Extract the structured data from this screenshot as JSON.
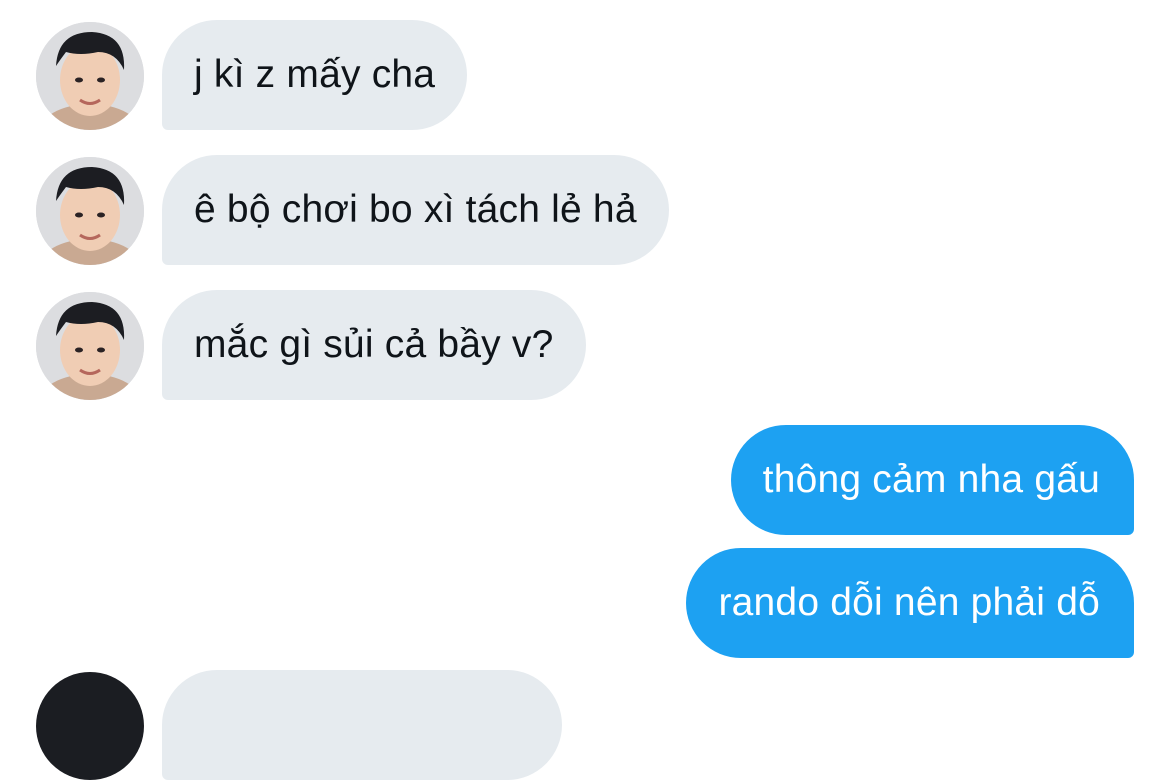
{
  "messages": [
    {
      "side": "incoming",
      "text": "j kì z mấy cha"
    },
    {
      "side": "incoming",
      "text": "ê bộ chơi bo xì tách lẻ hả"
    },
    {
      "side": "incoming",
      "text": "mắc gì sủi cả bầy v?"
    },
    {
      "side": "outgoing",
      "text": "thông cảm nha gấu"
    },
    {
      "side": "outgoing",
      "text": "rando dỗi nên phải dỗ"
    }
  ],
  "colors": {
    "incoming_bubble": "#e6ebef",
    "incoming_text": "#0f1419",
    "outgoing_bubble": "#1da1f2",
    "outgoing_text": "#ffffff"
  },
  "icons": {
    "avatar": "contact-avatar-photo"
  }
}
